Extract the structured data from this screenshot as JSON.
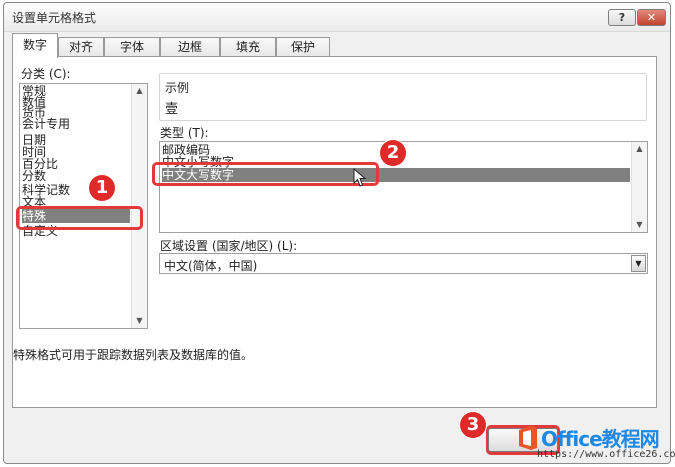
{
  "dialog": {
    "title": "设置单元格格式",
    "help_label": "?",
    "close_label": "✕"
  },
  "tabs": [
    {
      "label": "数字",
      "active": true
    },
    {
      "label": "对齐"
    },
    {
      "label": "字体"
    },
    {
      "label": "边框"
    },
    {
      "label": "填充"
    },
    {
      "label": "保护"
    }
  ],
  "category": {
    "label": "分类 (C):",
    "items": [
      "常规",
      "数值",
      "货币",
      "会计专用",
      "日期",
      "时间",
      "百分比",
      "分数",
      "科学记数",
      "文本",
      "特殊",
      "自定义"
    ],
    "selected": "特殊"
  },
  "sample": {
    "label": "示例",
    "value": "壹"
  },
  "type": {
    "label": "类型 (T):",
    "items": [
      "邮政编码",
      "中文小写数字",
      "中文大写数字"
    ],
    "selected": "中文大写数字"
  },
  "locale": {
    "label": "区域设置 (国家/地区) (L):",
    "value": "中文(简体，中国)"
  },
  "description": "特殊格式可用于跟踪数据列表及数据库的值。",
  "badges": [
    "1",
    "2",
    "3"
  ],
  "watermark": {
    "name": "Office教程网",
    "url": "https://www.office26.com"
  },
  "icons": {
    "cursor": "mouse-pointer-icon",
    "logo": "office-logo-icon"
  },
  "colors": {
    "highlight": "#e23a3a",
    "selection": "#808080",
    "close": "#c2432f"
  }
}
